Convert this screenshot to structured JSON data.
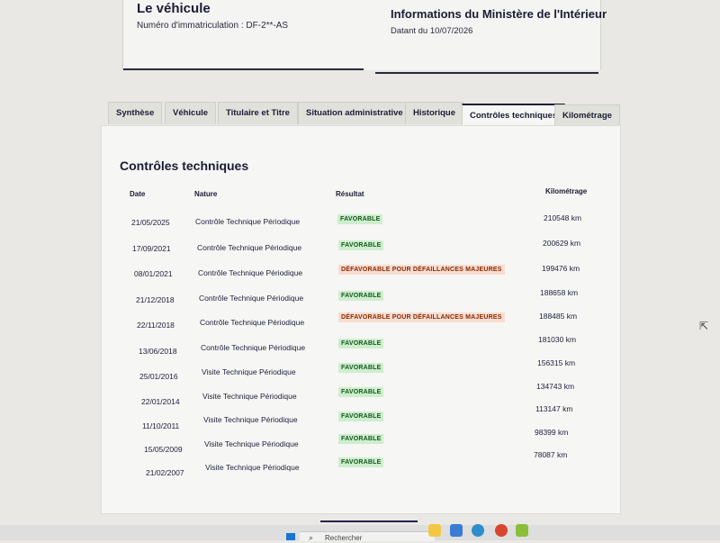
{
  "header": {
    "vehicle_title": "Le véhicule",
    "immatriculation_label": "Numéro d'immatriculation :",
    "immatriculation_value": "DF-2**-AS",
    "ministry_title": "Informations du Ministère de l'Intérieur",
    "date_label": "Datant du 10/07/2026"
  },
  "tabs": [
    {
      "label": "Synthèse"
    },
    {
      "label": "Véhicule"
    },
    {
      "label": "Titulaire et Titre"
    },
    {
      "label": "Situation administrative"
    },
    {
      "label": "Historique"
    },
    {
      "label": "Contrôles techniques",
      "active": true
    },
    {
      "label": "Kilométrage"
    }
  ],
  "section": {
    "title": "Contrôles techniques",
    "columns": [
      "Date",
      "Nature",
      "Résultat",
      "Kilométrage"
    ]
  },
  "rows": [
    {
      "date": "21/05/2025",
      "nature": "Contrôle Technique Périodique",
      "result": "FAVORABLE",
      "km": "210548 km"
    },
    {
      "date": "17/09/2021",
      "nature": "Contrôle Technique Périodique",
      "result": "FAVORABLE",
      "km": "200629 km"
    },
    {
      "date": "08/01/2021",
      "nature": "Contrôle Technique Périodique",
      "result": "DÉFAVORABLE POUR DÉFAILLANCES MAJEURES",
      "km": "199476 km"
    },
    {
      "date": "21/12/2018",
      "nature": "Contrôle Technique Périodique",
      "result": "FAVORABLE",
      "km": "188658 km"
    },
    {
      "date": "22/11/2018",
      "nature": "Contrôle Technique Périodique",
      "result": "DÉFAVORABLE POUR DÉFAILLANCES MAJEURES",
      "km": "188485 km"
    },
    {
      "date": "13/06/2018",
      "nature": "Contrôle Technique Périodique",
      "result": "FAVORABLE",
      "km": "181030 km"
    },
    {
      "date": "25/01/2016",
      "nature": "Visite Technique Périodique",
      "result": "FAVORABLE",
      "km": "156315 km"
    },
    {
      "date": "22/01/2014",
      "nature": "Visite Technique Périodique",
      "result": "FAVORABLE",
      "km": "134743 km"
    },
    {
      "date": "11/10/2011",
      "nature": "Visite Technique Périodique",
      "result": "FAVORABLE",
      "km": "113147 km"
    },
    {
      "date": "15/05/2009",
      "nature": "Visite Technique Périodique",
      "result": "FAVORABLE",
      "km": "98399 km"
    },
    {
      "date": "21/02/2007",
      "nature": "Visite Technique Périodique",
      "result": "FAVORABLE",
      "km": "78087 km"
    }
  ],
  "taskbar": {
    "search_placeholder": "Rechercher",
    "search_icon": "search-icon",
    "windows_icon": "windows-start-icon"
  },
  "colors": {
    "favorable_bg": "#cdeece",
    "favorable_text": "#17581e",
    "defavorable_bg": "#f7ddd1",
    "defavorable_text": "#8a2b00",
    "active_tab_border": "#1e1e3c"
  }
}
